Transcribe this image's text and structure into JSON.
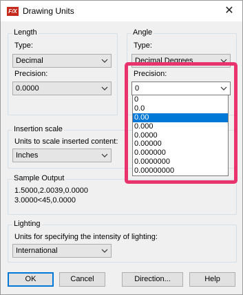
{
  "window": {
    "title": "Drawing Units",
    "app_icon": "F/X"
  },
  "length": {
    "legend": "Length",
    "type_label": "Type:",
    "type_value": "Decimal",
    "precision_label": "Precision:",
    "precision_value": "0.0000"
  },
  "angle": {
    "legend": "Angle",
    "type_label": "Type:",
    "type_value": "Decimal Degrees",
    "precision_label": "Precision:",
    "precision_value": "0",
    "precision_options": [
      "0",
      "0.0",
      "0.00",
      "0.000",
      "0.0000",
      "0.00000",
      "0.000000",
      "0.0000000",
      "0.00000000"
    ],
    "selected_option_index": 2
  },
  "insertion": {
    "legend": "Insertion scale",
    "label": "Units to scale inserted content:",
    "value": "Inches"
  },
  "sample": {
    "legend": "Sample Output",
    "line1": "1.5000,2.0039,0.0000",
    "line2": "3.0000<45,0.0000"
  },
  "lighting": {
    "legend": "Lighting",
    "label": "Units for specifying the intensity of lighting:",
    "value": "International"
  },
  "buttons": {
    "ok": "OK",
    "cancel": "Cancel",
    "direction": "Direction...",
    "help": "Help"
  },
  "colors": {
    "highlight": "#e8336d",
    "selection": "#0078d7"
  }
}
